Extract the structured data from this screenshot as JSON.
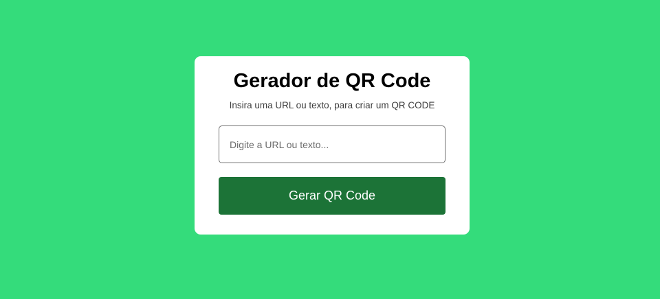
{
  "colors": {
    "background": "#34dc7b",
    "card": "#ffffff",
    "button": "#1c7337",
    "button_text": "#ffffff",
    "input_border": "#707070"
  },
  "card": {
    "title": "Gerador de QR Code",
    "subtitle": "Insira uma URL ou texto, para criar um QR CODE",
    "input": {
      "value": "",
      "placeholder": "Digite a URL ou texto..."
    },
    "button_label": "Gerar QR Code"
  }
}
